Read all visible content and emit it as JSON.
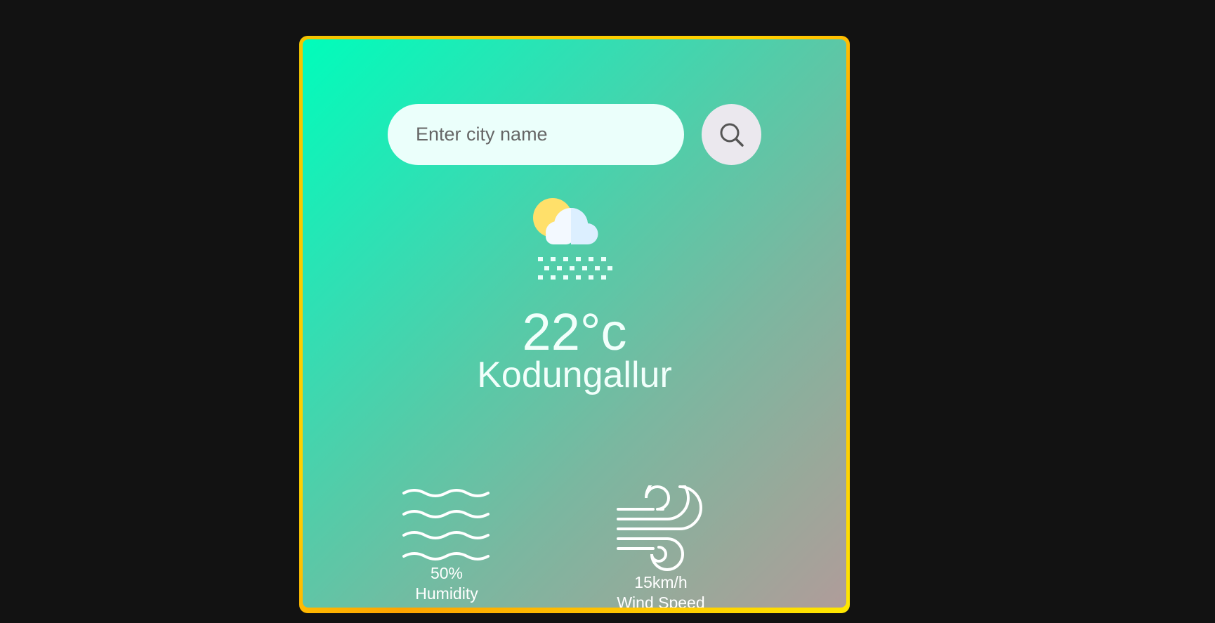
{
  "search": {
    "placeholder": "Enter city name",
    "value": "",
    "button_icon": "search-icon"
  },
  "weather": {
    "icon": "sun-cloud-snow-icon",
    "temperature": "22°c",
    "city": "Kodungallur"
  },
  "details": {
    "humidity": {
      "icon": "humidity-waves-icon",
      "value": "50%",
      "label": "Humidity"
    },
    "wind": {
      "icon": "wind-icon",
      "value": "15km/h",
      "label": "Wind Speed"
    }
  },
  "colors": {
    "background": "#121212",
    "border_gold": "#ffd200",
    "gradient_start": "#00fdbb",
    "gradient_end": "#b09c9a",
    "input_bg": "#ebfffb",
    "button_bg": "#ebe8ee"
  }
}
